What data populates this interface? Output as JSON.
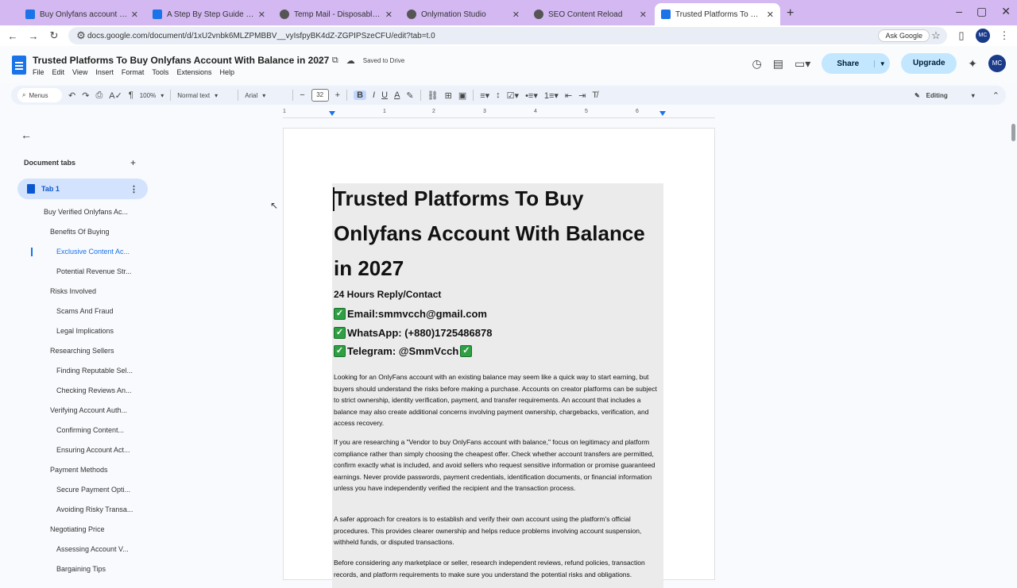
{
  "browser": {
    "tabs": [
      {
        "title": "Buy Onlyfans account With Balance",
        "icon": "doc"
      },
      {
        "title": "A Step By Step Guide To : Google Docs",
        "icon": "doc"
      },
      {
        "title": "Temp Mail - Disposable Temporary Email",
        "icon": "circle"
      },
      {
        "title": "Onlymation Studio",
        "icon": "circle"
      },
      {
        "title": "SEO Content Reload",
        "icon": "circle"
      },
      {
        "title": "Trusted Platforms To Buy Onlyfans",
        "icon": "doc",
        "active": true
      }
    ],
    "new_tab": "+",
    "url": "docs.google.com/document/d/1xU2vnbk6MLZPMBBV__vyIsfpyBK4dZ-ZGPIPSzeCFU/edit?tab=t.0",
    "ask_google": "Ask Google",
    "profile_initials": "MC"
  },
  "docs": {
    "title": "Trusted Platforms To Buy Onlyfans Account With Balance in 2027",
    "saved": "Saved to Drive",
    "menu": [
      "File",
      "Edit",
      "View",
      "Insert",
      "Format",
      "Tools",
      "Extensions",
      "Help"
    ],
    "share_label": "Share",
    "upgrade_label": "Upgrade",
    "avatar_initials": "MC"
  },
  "toolbar": {
    "menus_label": "Menus",
    "zoom": "100%",
    "style": "Normal text",
    "font": "Arial",
    "font_size": "32",
    "bold": "B",
    "italic": "I",
    "underline": "U",
    "text_color": "A",
    "editing_label": "Editing"
  },
  "ruler": {
    "labels": [
      "1",
      "1",
      "2",
      "3",
      "4",
      "5",
      "6"
    ]
  },
  "sidebar": {
    "heading": "Document tabs",
    "tab_label": "Tab 1",
    "outline": [
      {
        "label": "Buy Verified Onlyfans Ac...",
        "level": 1
      },
      {
        "label": "Benefits Of Buying",
        "level": 2
      },
      {
        "label": "Exclusive Content Ac...",
        "level": 3,
        "active": true
      },
      {
        "label": "Potential Revenue Str...",
        "level": 3
      },
      {
        "label": "Risks Involved",
        "level": 2
      },
      {
        "label": "Scams And Fraud",
        "level": 3
      },
      {
        "label": "Legal Implications",
        "level": 3
      },
      {
        "label": "Researching Sellers",
        "level": 2
      },
      {
        "label": "Finding Reputable Sel...",
        "level": 3
      },
      {
        "label": "Checking Reviews An...",
        "level": 3
      },
      {
        "label": "Verifying Account Auth...",
        "level": 2
      },
      {
        "label": "Confirming Content...",
        "level": 3
      },
      {
        "label": "Ensuring Account Act...",
        "level": 3
      },
      {
        "label": "Payment Methods",
        "level": 2
      },
      {
        "label": "Secure Payment Opti...",
        "level": 3
      },
      {
        "label": "Avoiding Risky Transa...",
        "level": 3
      },
      {
        "label": "Negotiating Price",
        "level": 2
      },
      {
        "label": "Assessing Account V...",
        "level": 3
      },
      {
        "label": "Bargaining Tips",
        "level": 3
      }
    ]
  },
  "document": {
    "title": "Trusted Platforms To Buy Onlyfans Account With Balance in 2027",
    "contact_heading": "24 Hours Reply/Contact",
    "email": "Email:smmvcch@gmail.com",
    "whatsapp": "WhatsApp: (+880)1725486878",
    "telegram": "Telegram: @SmmVcch",
    "paragraphs": [
      "Looking for an OnlyFans account with an existing balance may seem like a quick way to start earning, but buyers should understand the risks before making a purchase. Accounts on creator platforms can be subject to strict ownership, identity verification, payment, and transfer requirements. An account that includes a balance may also create additional concerns involving payment ownership, chargebacks, verification, and access recovery.",
      "If you are researching a \"Vendor to buy OnlyFans account with balance,\" focus on legitimacy and platform compliance rather than simply choosing the cheapest offer. Check whether account transfers are permitted, confirm exactly what is included, and avoid sellers who request sensitive information or promise guaranteed earnings. Never provide passwords, payment credentials, identification documents, or financial information unless you have independently verified the recipient and the transaction process.",
      "A safer approach for creators is to establish and verify their own account using the platform's official procedures. This provides clearer ownership and helps reduce problems involving account suspension, withheld funds, or disputed transactions.",
      "Before considering any marketplace or seller, research independent reviews, refund policies, transaction records, and platform requirements to make sure you understand the potential risks and obligations."
    ]
  },
  "colors": {
    "tabstrip": "#d3b8f2",
    "accent": "#1a73e8",
    "share": "#c2e7ff",
    "check": "#2ea043"
  }
}
